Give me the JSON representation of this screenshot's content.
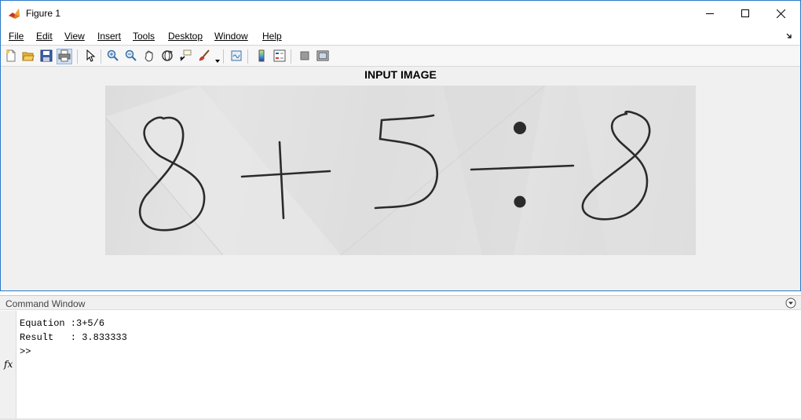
{
  "window": {
    "title": "Figure 1",
    "icon": "matlab-icon",
    "controls": [
      "minimize-icon",
      "maximize-icon",
      "close-icon"
    ]
  },
  "menubar": {
    "items": [
      {
        "label": "File",
        "underline": "F"
      },
      {
        "label": "Edit",
        "underline": "E"
      },
      {
        "label": "View",
        "underline": "V"
      },
      {
        "label": "Insert",
        "underline": "I"
      },
      {
        "label": "Tools",
        "underline": "T"
      },
      {
        "label": "Desktop",
        "underline": "D"
      },
      {
        "label": "Window",
        "underline": "W"
      },
      {
        "label": "Help",
        "underline": "H"
      }
    ]
  },
  "toolbar": {
    "buttons": [
      "new-figure-icon",
      "open-file-icon",
      "save-icon",
      "print-icon",
      "edit-plot-icon",
      "zoom-in-icon",
      "zoom-out-icon",
      "pan-icon",
      "rotate-3d-icon",
      "data-cursor-icon",
      "brush-icon",
      "link-plot-icon",
      "colorbar-icon",
      "legend-icon",
      "hide-plot-tools-icon",
      "show-plot-tools-icon"
    ]
  },
  "figure": {
    "axes_title": "INPUT IMAGE",
    "image_content": "handwritten equation 8 + 5 ÷ 8"
  },
  "command_window": {
    "title": "Command Window",
    "lines": [
      "Equation :3+5/6",
      "Result   : 3.833333",
      ">>"
    ],
    "fx_label": "fx"
  },
  "colors": {
    "window_border": "#2b79c8",
    "figure_bg": "#f0f0f0",
    "image_paper": "#e0e0e0",
    "ink": "#2b2b2b"
  }
}
